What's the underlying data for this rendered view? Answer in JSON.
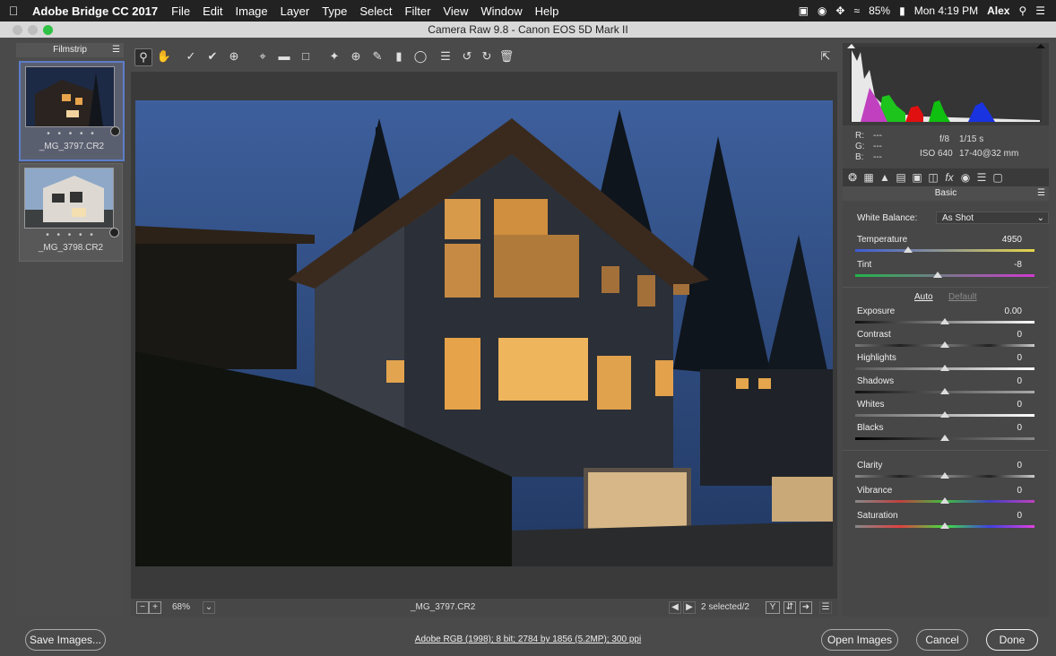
{
  "menubar": {
    "app_name": "Adobe Bridge CC 2017",
    "items": [
      "File",
      "Edit",
      "Image",
      "Layer",
      "Type",
      "Select",
      "Filter",
      "View",
      "Window",
      "Help"
    ],
    "battery": "85%",
    "clock": "Mon 4:19 PM",
    "user": "Alex"
  },
  "window": {
    "title": "Camera Raw 9.8  -  Canon EOS 5D Mark II"
  },
  "filmstrip": {
    "header": "Filmstrip",
    "items": [
      {
        "name": "_MG_3797.CR2",
        "rating_dots": "• • • • •"
      },
      {
        "name": "_MG_3798.CR2",
        "rating_dots": "• • • • •"
      }
    ]
  },
  "status": {
    "zoom": "68%",
    "filename": "_MG_3797.CR2",
    "selected": "2 selected/2",
    "y_toggle": "Y"
  },
  "info": {
    "r_label": "R:",
    "r_val": "---",
    "g_label": "G:",
    "g_val": "---",
    "b_label": "B:",
    "b_val": "---",
    "aperture": "f/8",
    "shutter": "1/15 s",
    "iso": "ISO 640",
    "lens": "17-40@32 mm"
  },
  "panel": {
    "title": "Basic",
    "wb_label": "White Balance:",
    "wb_value": "As Shot",
    "auto": "Auto",
    "default": "Default",
    "sliders": [
      {
        "label": "Temperature",
        "value": "4950"
      },
      {
        "label": "Tint",
        "value": "-8"
      },
      {
        "label": "Exposure",
        "value": "0.00"
      },
      {
        "label": "Contrast",
        "value": "0"
      },
      {
        "label": "Highlights",
        "value": "0"
      },
      {
        "label": "Shadows",
        "value": "0"
      },
      {
        "label": "Whites",
        "value": "0"
      },
      {
        "label": "Blacks",
        "value": "0"
      },
      {
        "label": "Clarity",
        "value": "0"
      },
      {
        "label": "Vibrance",
        "value": "0"
      },
      {
        "label": "Saturation",
        "value": "0"
      }
    ]
  },
  "footer": {
    "save": "Save Images...",
    "workflow": "Adobe RGB (1998); 8 bit; 2784 by 1856 (5.2MP); 300 ppi",
    "open": "Open Images",
    "cancel": "Cancel",
    "done": "Done"
  },
  "colors": {
    "accent": "#5c7ec9",
    "panel": "#474747",
    "menubar": "#222222"
  }
}
